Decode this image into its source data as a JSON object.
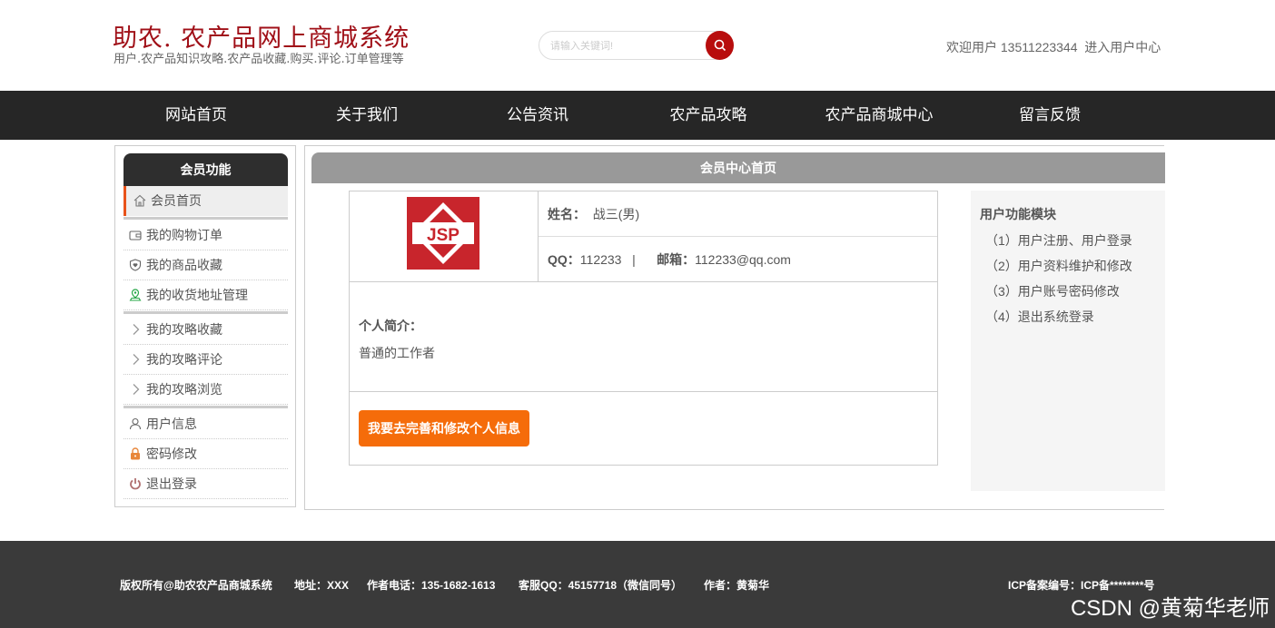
{
  "header": {
    "title": "助农. 农产品网上商城系统",
    "subtitle": "用户.农产品知识攻略.农产品收藏.购买.评论.订单管理等",
    "search_placeholder": "请输入关键词!",
    "welcome": "欢迎用户 13511223344",
    "user_center_link": "进入用户中心"
  },
  "nav": {
    "items": [
      "网站首页",
      "关于我们",
      "公告资讯",
      "农产品攻略",
      "农产品商城中心",
      "留言反馈"
    ]
  },
  "sidebar": {
    "title": "会员功能",
    "items": [
      {
        "label": "会员首页",
        "icon": "home-icon"
      },
      {
        "label": "我的购物订单",
        "icon": "wallet-icon"
      },
      {
        "label": "我的商品收藏",
        "icon": "shield-heart-icon"
      },
      {
        "label": "我的收货地址管理",
        "icon": "location-icon"
      },
      {
        "label": "我的攻略收藏",
        "icon": "chevron-right-icon"
      },
      {
        "label": "我的攻略评论",
        "icon": "chevron-right-icon"
      },
      {
        "label": "我的攻略浏览",
        "icon": "chevron-right-icon"
      },
      {
        "label": "用户信息",
        "icon": "user-icon"
      },
      {
        "label": "密码修改",
        "icon": "lock-icon"
      },
      {
        "label": "退出登录",
        "icon": "power-icon"
      }
    ]
  },
  "main": {
    "title": "会员中心首页",
    "avatar_text": "JSP",
    "name_label": "姓名：",
    "name_value": "战三(男)",
    "qq_label": "QQ：",
    "qq_value": "112233",
    "separator": "|",
    "email_label": "邮箱：",
    "email_value": "112233@qq.com",
    "intro_label": "个人简介：",
    "intro_value": "普通的工作者",
    "edit_button": "我要去完善和修改个人信息"
  },
  "functions": {
    "title": "用户功能模块",
    "items": [
      "（1）用户注册、用户登录",
      "（2）用户资料维护和修改",
      "（3）用户账号密码修改",
      "（4）退出系统登录"
    ]
  },
  "footer": {
    "copyright": "版权所有@助农农产品商城系统",
    "address": "地址：XXX",
    "phone": "作者电话：135-1682-1613",
    "qq": "客服QQ：45157718（微信同号）",
    "author": "作者：黄菊华",
    "icp": "ICP备案编号：ICP备********号",
    "watermark": "CSDN @黄菊华老师"
  },
  "colors": {
    "brand": "#a01018",
    "nav_bg": "#262626",
    "accent_orange": "#f56c0a",
    "search_btn": "#b80d0d",
    "footer_bg": "#3a3a3a"
  }
}
